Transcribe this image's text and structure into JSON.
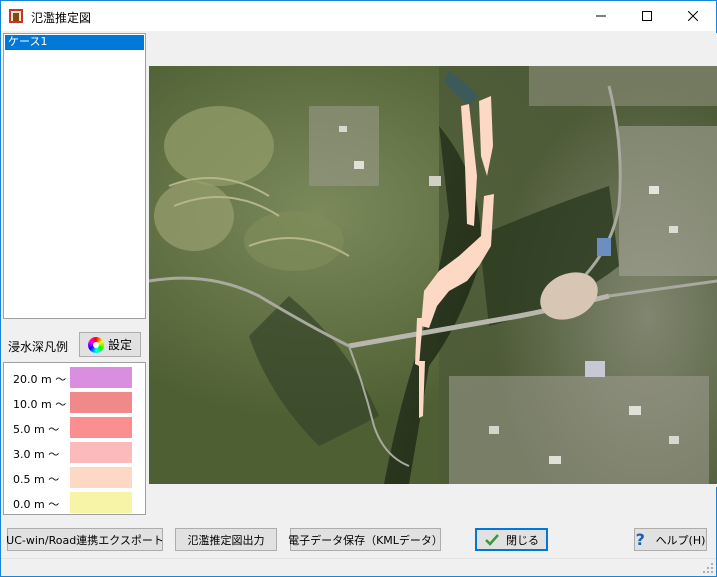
{
  "window": {
    "title": "氾濫推定図"
  },
  "case_list": {
    "items": [
      "ケース1"
    ]
  },
  "legend": {
    "label": "浸水深凡例",
    "settings_button": "設定",
    "rows": [
      {
        "label": "20.0 m 〜",
        "color": "#d98ee0"
      },
      {
        "label": "10.0 m 〜",
        "color": "#f08a8a"
      },
      {
        "label": "5.0 m 〜",
        "color": "#fb8f8f"
      },
      {
        "label": "3.0 m 〜",
        "color": "#fcbaba"
      },
      {
        "label": "0.5 m 〜",
        "color": "#fcd8c5"
      },
      {
        "label": "0.0 m 〜",
        "color": "#f7f3a7"
      }
    ]
  },
  "buttons": {
    "export_road": "UC-win/Road連携エクスポート",
    "output_map": "氾濫推定図出力",
    "save_kml": "電子データ保存（KMLデータ）",
    "close": "閉じる",
    "help": "ヘルプ(H)"
  },
  "colors": {
    "accent": "#0078d7",
    "flood": "#fcd8c5"
  }
}
